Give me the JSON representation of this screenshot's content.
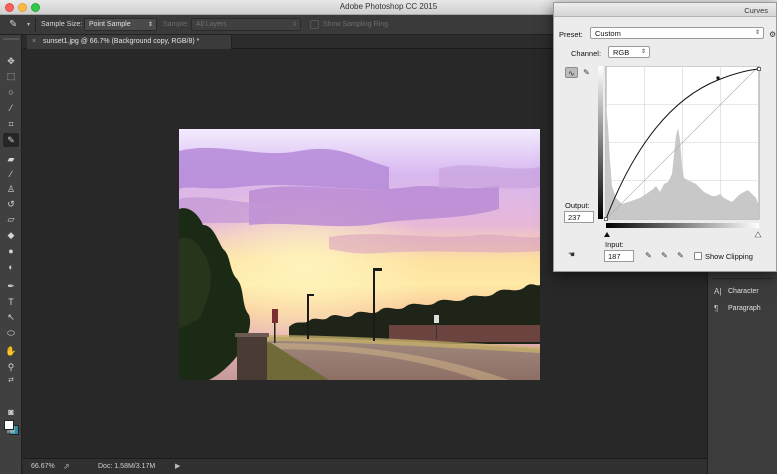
{
  "window": {
    "title": "Adobe Photoshop CC 2015"
  },
  "options_bar": {
    "tool_icon": "eyedropper-icon",
    "sample_size_label": "Sample Size:",
    "sample_size_value": "Point Sample",
    "sample_label": "Sample:",
    "sample_value": "All Layers",
    "show_sampling_ring_label": "Show Sampling Ring"
  },
  "document": {
    "tab_title": "sunset1.jpg @ 66.7% (Background copy, RGB/8) *"
  },
  "status_bar": {
    "zoom": "66.67%",
    "doc_size": "Doc: 1.58M/3.17M"
  },
  "panels": [
    {
      "icon": "character-icon",
      "label": "Character"
    },
    {
      "icon": "paragraph-icon",
      "label": "Paragraph"
    }
  ],
  "curves": {
    "title": "Curves",
    "preset_label": "Preset:",
    "preset_value": "Custom",
    "channel_label": "Channel:",
    "channel_value": "RGB",
    "output_label": "Output:",
    "output_value": "237",
    "input_label": "Input:",
    "input_value": "187",
    "show_clipping_label": "Show Clipping",
    "control_point": {
      "input": 187,
      "output": 237
    }
  },
  "colors": {
    "foreground": "#ffffff",
    "background": "#2a8ea0"
  }
}
